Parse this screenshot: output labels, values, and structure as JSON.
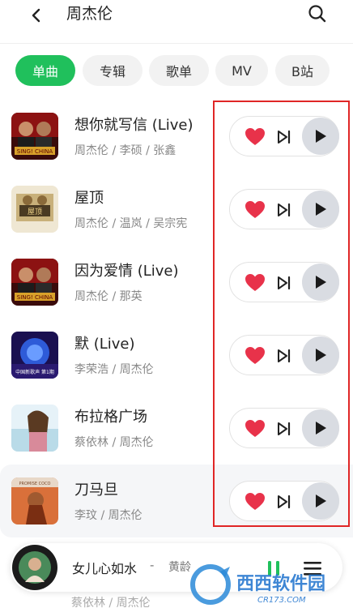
{
  "header": {
    "title": "周杰伦",
    "back_icon": "chevron-left-icon",
    "search_icon": "search-icon"
  },
  "tabs": [
    {
      "label": "单曲",
      "active": true
    },
    {
      "label": "专辑",
      "active": false
    },
    {
      "label": "歌单",
      "active": false
    },
    {
      "label": "MV",
      "active": false
    },
    {
      "label": "B站",
      "active": false
    }
  ],
  "songs": [
    {
      "title": "想你就写信 (Live)",
      "artist": "周杰伦 / 李硕 / 张鑫",
      "cover_text": "SING! CHINA",
      "liked": true
    },
    {
      "title": "屋顶",
      "artist": "周杰伦 / 温岚 / 吴宗宪",
      "cover_text": "屋顶",
      "liked": true
    },
    {
      "title": "因为爱情 (Live)",
      "artist": "周杰伦 / 那英",
      "cover_text": "SING! CHINA",
      "liked": true
    },
    {
      "title": "默 (Live)",
      "artist": "李荣浩 / 周杰伦",
      "cover_text": "中国新歌声 第1期",
      "liked": true
    },
    {
      "title": "布拉格广场",
      "artist": "蔡依林 / 周杰伦",
      "cover_text": "",
      "liked": true
    },
    {
      "title": "刀马旦",
      "artist": "李玟 / 周杰伦",
      "cover_text": "PROMISE COCO",
      "liked": true
    }
  ],
  "mini_player": {
    "title": "女儿心如水",
    "separator": "-",
    "artist": "黄龄",
    "pause_icon": "pause-icon",
    "menu_icon": "playlist-icon"
  },
  "under_row_artist": "蔡依林 / 周杰伦",
  "watermark": {
    "brand": "西西软件园",
    "url": "CR173.COM"
  },
  "colors": {
    "accent": "#20c05c",
    "heart": "#e8324a",
    "highlight": "#e02626"
  }
}
